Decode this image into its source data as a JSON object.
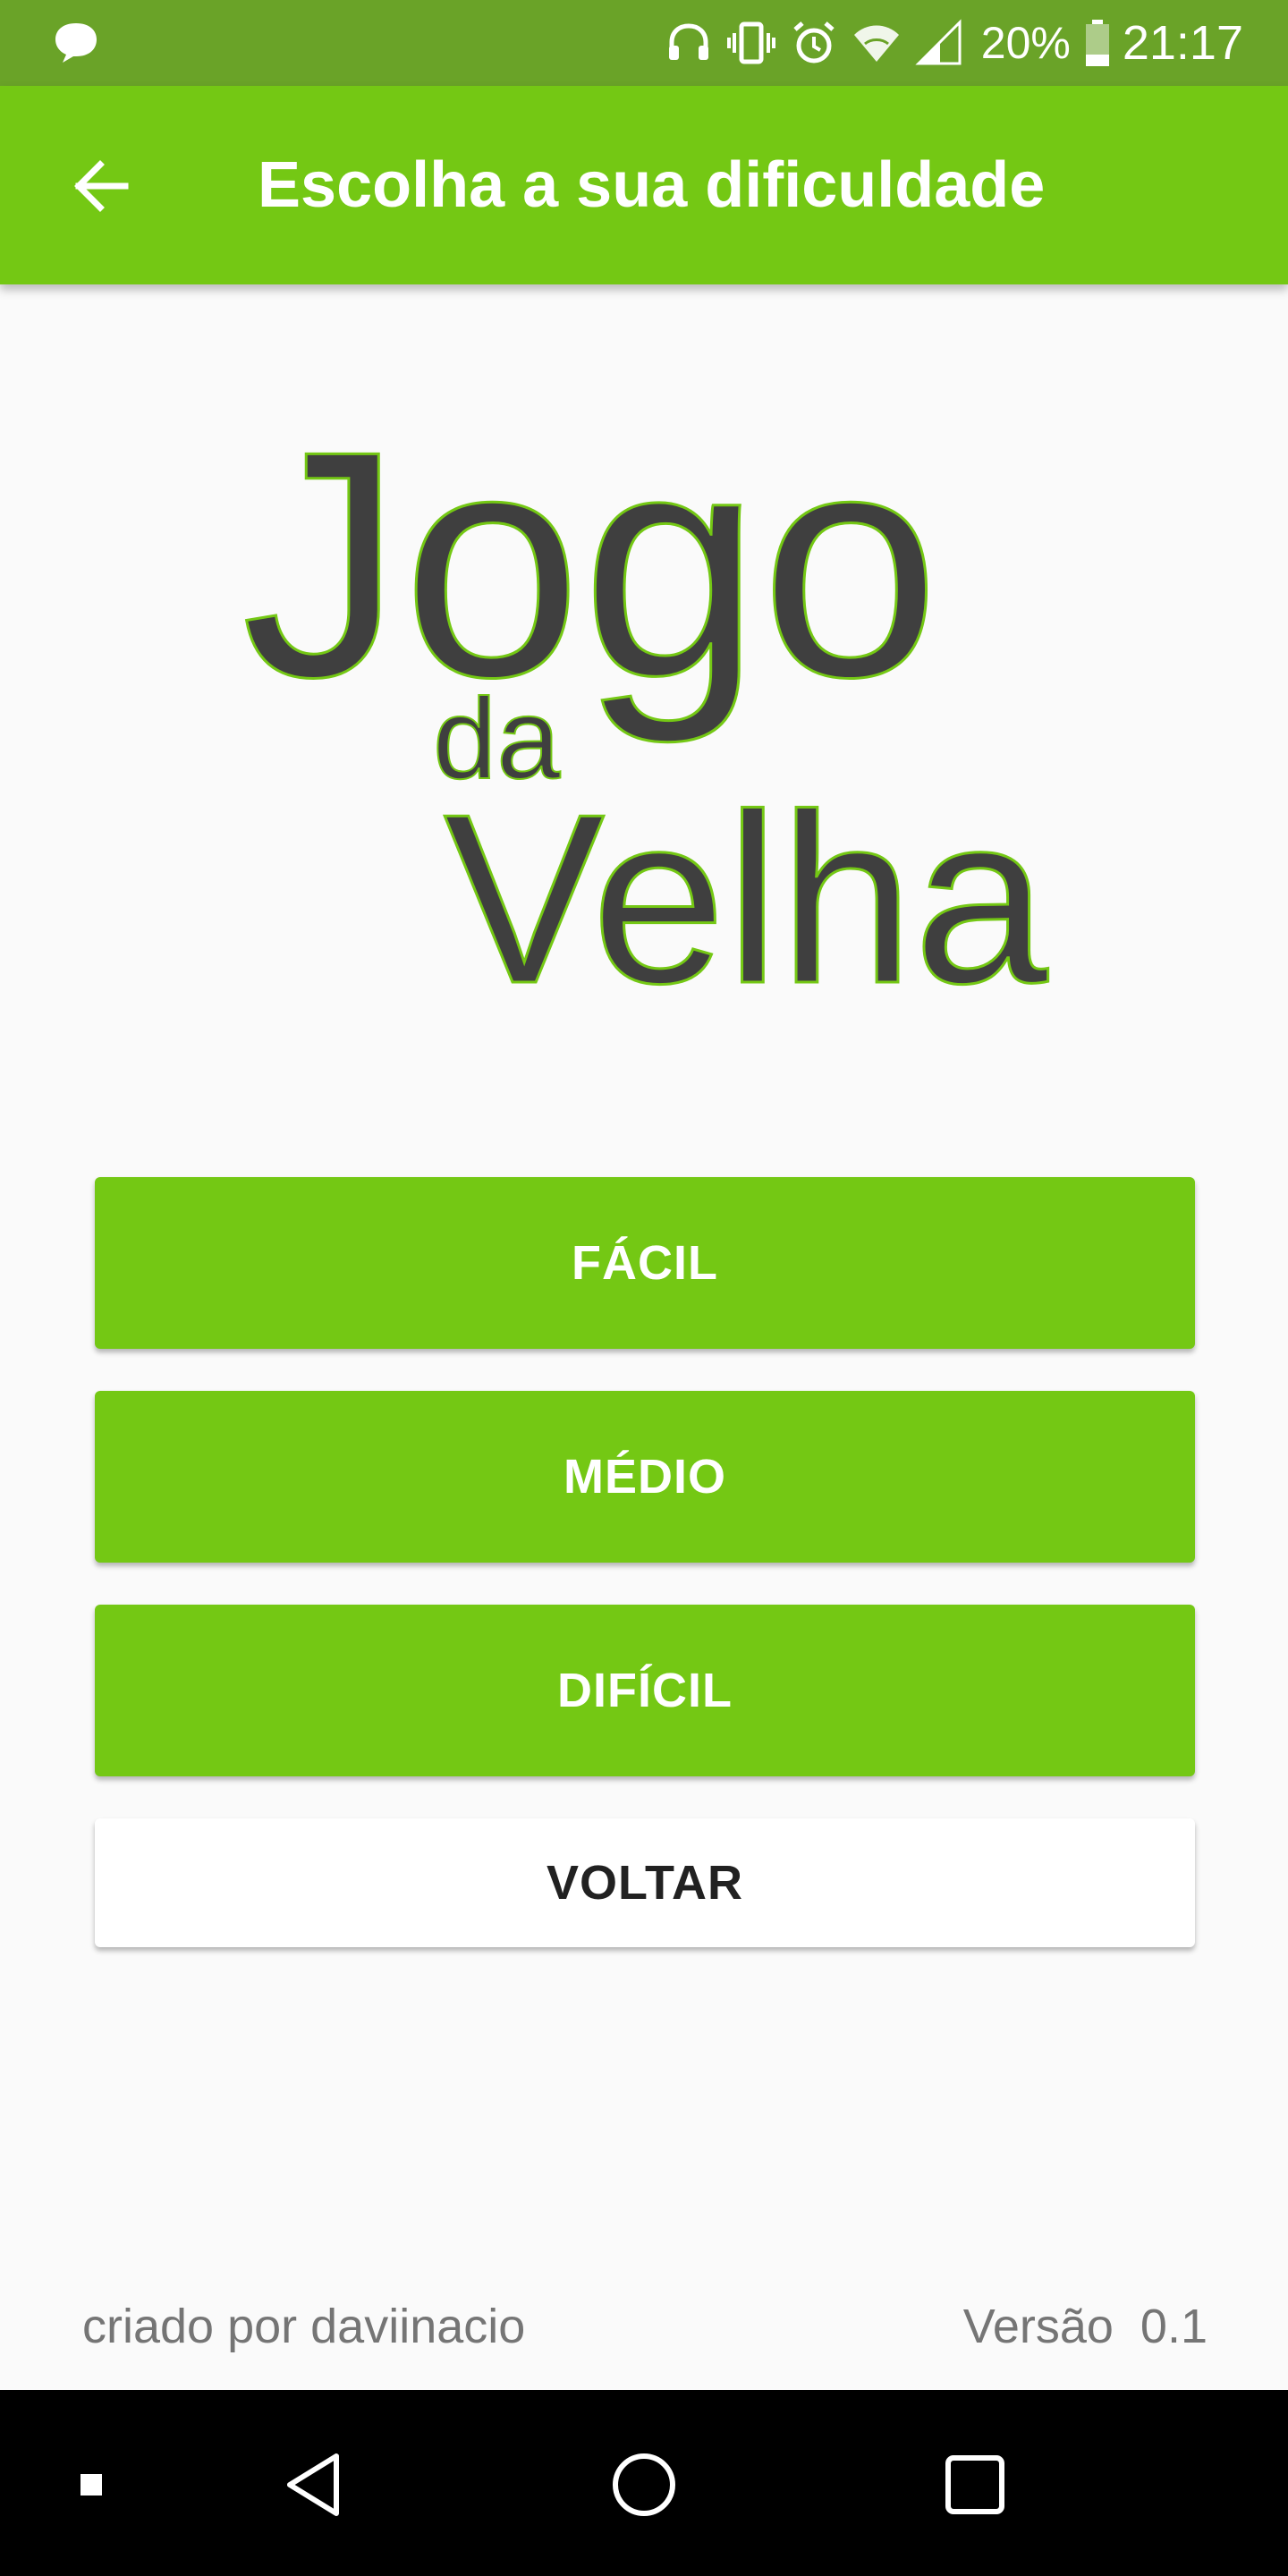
{
  "status_bar": {
    "battery": "20%",
    "time": "21:17",
    "icons": [
      "chat-bubble-icon",
      "headphones-icon",
      "vibrate-icon",
      "alarm-icon",
      "wifi-icon",
      "signal-icon",
      "battery-icon"
    ]
  },
  "app_bar": {
    "title": "Escolha a sua dificuldade",
    "back_icon": "arrow-left-icon"
  },
  "logo": {
    "line1": "Jogo",
    "line2": "da",
    "line3": "Velha",
    "text_color": "#3f3f3f",
    "outline_color": "#74c814"
  },
  "buttons": {
    "easy": "FÁCIL",
    "medium": "MÉDIO",
    "hard": "DIFÍCIL",
    "back": "VOLTAR"
  },
  "footer": {
    "author": "criado por daviinacio",
    "version": "Versão  0.1"
  },
  "nav_bar": {
    "icons": [
      "square-small-icon",
      "back-triangle-icon",
      "home-circle-icon",
      "recents-square-icon"
    ]
  },
  "colors": {
    "accent": "#74c814",
    "status_bar": "#6aa328",
    "background": "#fafafa"
  }
}
